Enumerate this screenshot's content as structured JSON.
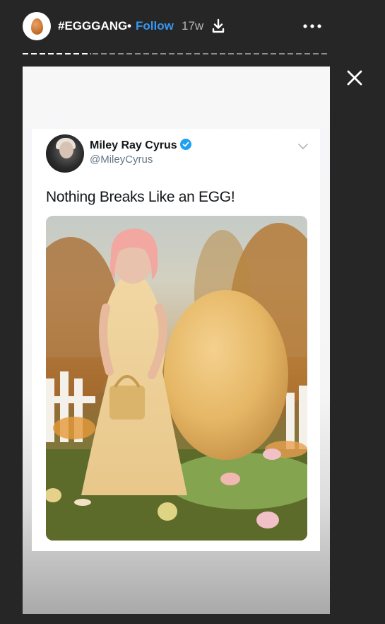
{
  "story_header": {
    "account_name": "#EGGGANG",
    "separator": "•",
    "follow_label": "Follow",
    "posted_ago": "17w"
  },
  "tweet": {
    "display_name": "Miley Ray Cyrus",
    "handle": "@MileyCyrus",
    "text": "Nothing Breaks Like an EGG!"
  },
  "colors": {
    "background": "#262626",
    "follow_blue": "#3897f0",
    "verified_blue": "#1da1f2"
  },
  "icons": [
    "egg-avatar-icon",
    "download-icon",
    "more-options-icon",
    "close-icon",
    "verified-badge-icon",
    "chevron-down-icon"
  ]
}
